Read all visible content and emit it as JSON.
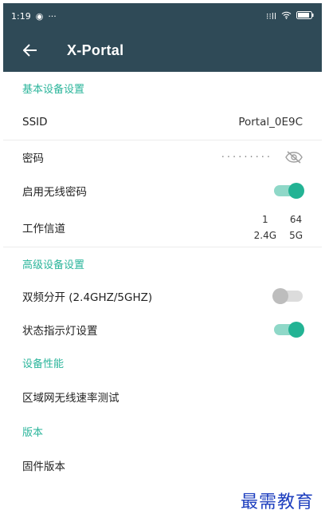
{
  "status_bar": {
    "time": "1:19",
    "indicators": "···",
    "signal_text": "⁝⁝ll",
    "wifi_icon": "wifi-icon",
    "battery_icon": "battery-icon"
  },
  "toolbar": {
    "title": "X-Portal",
    "back_icon": "arrow-left-icon"
  },
  "sections": {
    "basic": {
      "header": "基本设备设置"
    },
    "advanced": {
      "header": "高级设备设置"
    },
    "performance": {
      "header": "设备性能"
    },
    "version": {
      "header": "版本"
    }
  },
  "rows": {
    "ssid": {
      "label": "SSID",
      "value": "Portal_0E9C"
    },
    "password": {
      "label": "密码",
      "masked": "·········"
    },
    "wireless_password": {
      "label": "启用无线密码",
      "enabled": true
    },
    "channel": {
      "label": "工作信道",
      "ch_24": "1",
      "ch_5": "64",
      "band_24": "2.4G",
      "band_5": "5G"
    },
    "dual_band": {
      "label": "双频分开 (2.4GHZ/5GHZ)",
      "enabled": false
    },
    "status_led": {
      "label": "状态指示灯设置",
      "enabled": true
    },
    "speed_test": {
      "label": "区域网无线速率测试"
    },
    "firmware": {
      "label": "固件版本"
    }
  },
  "footer": {
    "watermark": "最需教育"
  },
  "colors": {
    "toolbar": "#2f4a57",
    "accent": "#2bb59b",
    "switch_on": "#23b394",
    "switch_off": "#bdbdbd",
    "watermark": "#1e3fbf"
  }
}
